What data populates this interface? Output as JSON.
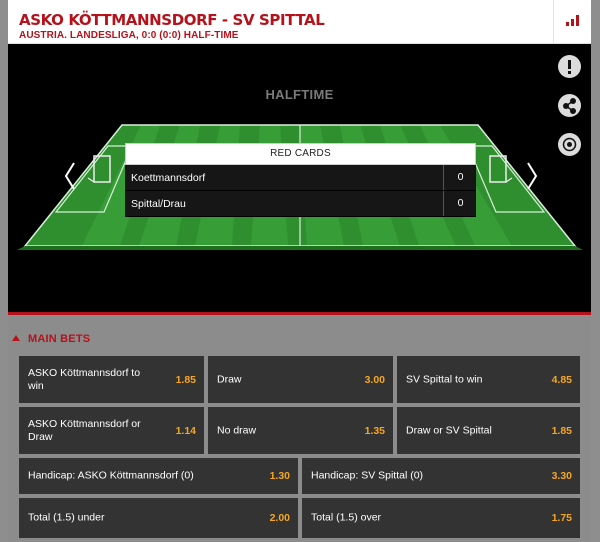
{
  "header": {
    "title": "ASKO KÖTTMANNSDORF - SV SPITTAL",
    "subtitle": "AUSTRIA. LANDESLIGA, 0:0 (0:0) HALF-TIME",
    "stats_icon": "bar-chart-icon"
  },
  "stage": {
    "status": "HALFTIME",
    "side_buttons": [
      "alert-icon",
      "share-icon",
      "settings-icon"
    ],
    "red_cards": {
      "heading": "RED CARDS",
      "rows": [
        {
          "team": "Koettmannsdorf",
          "count": "0"
        },
        {
          "team": "Spittal/Drau",
          "count": "0"
        }
      ]
    }
  },
  "main_bets": {
    "title": "MAIN BETS",
    "row1": [
      {
        "label": "ASKO Köttmannsdorf to win",
        "odd": "1.85"
      },
      {
        "label": "Draw",
        "odd": "3.00"
      },
      {
        "label": "SV Spittal to win",
        "odd": "4.85"
      }
    ],
    "row2": [
      {
        "label": "ASKO Köttmannsdorf or Draw",
        "odd": "1.14"
      },
      {
        "label": "No draw",
        "odd": "1.35"
      },
      {
        "label": "Draw or SV Spittal",
        "odd": "1.85"
      }
    ],
    "row3": [
      {
        "label": "Handicap: ASKO Köttmannsdorf (0)",
        "odd": "1.30"
      },
      {
        "label": "Handicap: SV Spittal (0)",
        "odd": "3.30"
      }
    ],
    "row4": [
      {
        "label": "Total (1.5) under",
        "odd": "2.00"
      },
      {
        "label": "Total (1.5) over",
        "odd": "1.75"
      }
    ]
  },
  "colors": {
    "accent": "#b5121b",
    "odds": "#f5a623",
    "cell": "#333333",
    "pitch": "#2e8f2e"
  }
}
